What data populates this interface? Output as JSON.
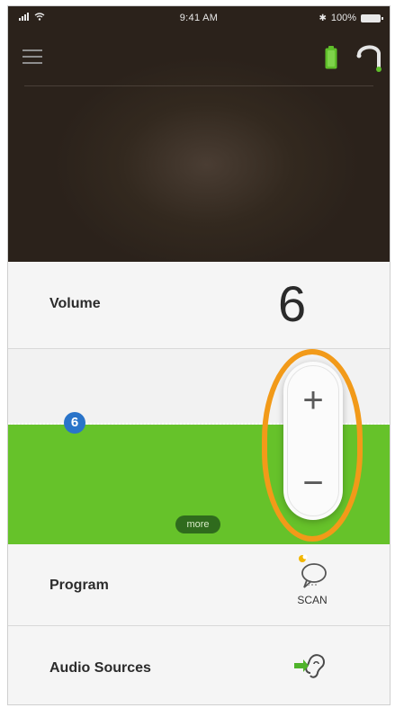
{
  "status_bar": {
    "time": "9:41 AM",
    "battery_text": "100%"
  },
  "volume": {
    "label": "Volume",
    "value": "6",
    "level_badge": "6"
  },
  "controls": {
    "plus": "+",
    "minus": "−",
    "more_label": "more"
  },
  "program": {
    "label": "Program",
    "scan_label": "SCAN"
  },
  "audio_sources": {
    "label": "Audio Sources"
  },
  "colors": {
    "accent_green": "#66c22a",
    "highlight_orange": "#f29a19",
    "badge_blue": "#2a74c9",
    "header_dark": "#2b221b"
  },
  "icons": [
    "menu-icon",
    "battery-icon",
    "hearing-aid-icon",
    "scan-icon",
    "audio-streaming-icon"
  ]
}
